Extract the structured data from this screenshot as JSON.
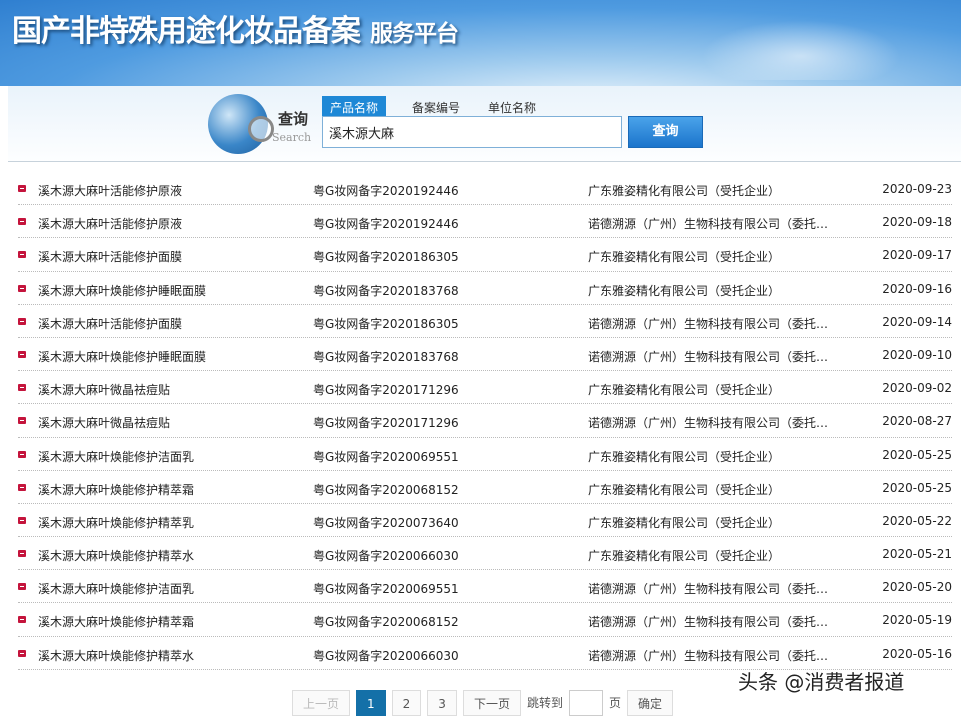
{
  "header": {
    "title": "国产非特殊用途化妆品备案",
    "subtitle": "服务平台"
  },
  "search": {
    "label": "查询",
    "label_en": "Search",
    "tabs": [
      "产品名称",
      "备案编号",
      "单位名称"
    ],
    "value": "溪木源大麻",
    "button": "查询"
  },
  "rows": [
    [
      "溪木源大麻叶活能修护原液",
      "粤G妆网备字2020192446",
      "广东雅姿精化有限公司（受托企业）",
      "2020-09-23"
    ],
    [
      "溪木源大麻叶活能修护原液",
      "粤G妆网备字2020192446",
      "诺德溯源（广州）生物科技有限公司（委托…",
      "2020-09-18"
    ],
    [
      "溪木源大麻叶活能修护面膜",
      "粤G妆网备字2020186305",
      "广东雅姿精化有限公司（受托企业）",
      "2020-09-17"
    ],
    [
      "溪木源大麻叶焕能修护睡眠面膜",
      "粤G妆网备字2020183768",
      "广东雅姿精化有限公司（受托企业）",
      "2020-09-16"
    ],
    [
      "溪木源大麻叶活能修护面膜",
      "粤G妆网备字2020186305",
      "诺德溯源（广州）生物科技有限公司（委托…",
      "2020-09-14"
    ],
    [
      "溪木源大麻叶焕能修护睡眠面膜",
      "粤G妆网备字2020183768",
      "诺德溯源（广州）生物科技有限公司（委托…",
      "2020-09-10"
    ],
    [
      "溪木源大麻叶微晶祛痘贴",
      "粤G妆网备字2020171296",
      "广东雅姿精化有限公司（受托企业）",
      "2020-09-02"
    ],
    [
      "溪木源大麻叶微晶祛痘贴",
      "粤G妆网备字2020171296",
      "诺德溯源（广州）生物科技有限公司（委托…",
      "2020-08-27"
    ],
    [
      "溪木源大麻叶焕能修护洁面乳",
      "粤G妆网备字2020069551",
      "广东雅姿精化有限公司（受托企业）",
      "2020-05-25"
    ],
    [
      "溪木源大麻叶焕能修护精萃霜",
      "粤G妆网备字2020068152",
      "广东雅姿精化有限公司（受托企业）",
      "2020-05-25"
    ],
    [
      "溪木源大麻叶焕能修护精萃乳",
      "粤G妆网备字2020073640",
      "广东雅姿精化有限公司（受托企业）",
      "2020-05-22"
    ],
    [
      "溪木源大麻叶焕能修护精萃水",
      "粤G妆网备字2020066030",
      "广东雅姿精化有限公司（受托企业）",
      "2020-05-21"
    ],
    [
      "溪木源大麻叶焕能修护洁面乳",
      "粤G妆网备字2020069551",
      "诺德溯源（广州）生物科技有限公司（委托…",
      "2020-05-20"
    ],
    [
      "溪木源大麻叶焕能修护精萃霜",
      "粤G妆网备字2020068152",
      "诺德溯源（广州）生物科技有限公司（委托…",
      "2020-05-19"
    ],
    [
      "溪木源大麻叶焕能修护精萃水",
      "粤G妆网备字2020066030",
      "诺德溯源（广州）生物科技有限公司（委托…",
      "2020-05-16"
    ]
  ],
  "pager": {
    "prev": "上一页",
    "pages": [
      "1",
      "2",
      "3"
    ],
    "current": "1",
    "next": "下一页",
    "jump_label": "跳转到",
    "page_unit": "页",
    "confirm": "确定"
  },
  "watermark": "头条 @消费者报道"
}
